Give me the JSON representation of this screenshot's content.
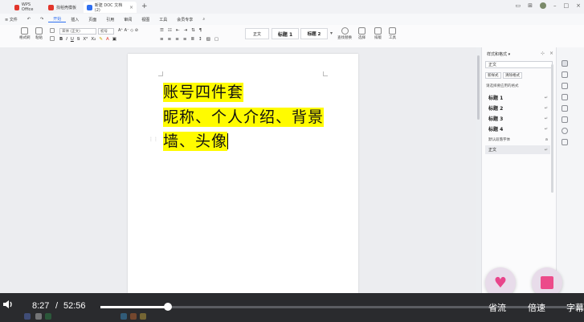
{
  "titlebar": {
    "tabs": [
      {
        "label": "WPS Office",
        "color": "#e2352b",
        "active": false
      },
      {
        "label": "找稻壳模板",
        "color": "#e2352b",
        "active": false
      },
      {
        "label": "新建 DOC 文档(2)",
        "color": "#2f6ff0",
        "active": true
      }
    ],
    "add_tab": "+"
  },
  "menubar": {
    "items": [
      "≡ 文件",
      "开始",
      "插入",
      "页面",
      "引用",
      "审阅",
      "视图",
      "工具",
      "会员专享"
    ],
    "active_index": 1
  },
  "ribbon": {
    "format_painter": "格式刷",
    "paste": "粘贴",
    "font_name": "宋体 (正文)",
    "font_size": "初号",
    "style_normal": "正文",
    "style_h1": "标题 1",
    "style_h2": "标题 2",
    "find_replace": "查找替换",
    "select": "选择",
    "layout": "排版",
    "toolbox": "工具"
  },
  "document": {
    "lines": [
      "账号四件套",
      "昵称、个人介绍、背景",
      "墙、头像"
    ],
    "highlight_color": "#fffb00"
  },
  "style_panel": {
    "title": "样式和格式 ▾",
    "current_style": "正文",
    "new_style": "新样式",
    "clear_format": "清除格式",
    "subtitle": "请选择要应用的格式",
    "items": [
      {
        "label": "标题 1",
        "mark": "↵",
        "kind": "heading"
      },
      {
        "label": "标题 2",
        "mark": "↵",
        "kind": "heading"
      },
      {
        "label": "标题 3",
        "mark": "↵",
        "kind": "heading"
      },
      {
        "label": "标题 4",
        "mark": "↵",
        "kind": "heading"
      },
      {
        "label": "默认段落字体",
        "mark": "a",
        "kind": "small"
      },
      {
        "label": "正文",
        "mark": "↵",
        "kind": "normal"
      }
    ]
  },
  "video": {
    "current_time": "8:27",
    "separator": "/",
    "duration": "52:56",
    "progress": 0.14,
    "quality": "省流",
    "speed": "倍速",
    "subtitles": "字幕"
  }
}
